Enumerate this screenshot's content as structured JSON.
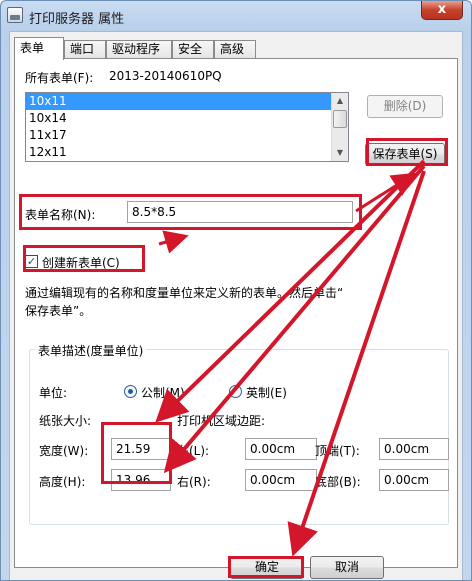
{
  "window": {
    "title": "打印服务器 属性",
    "close_label": "x"
  },
  "tabs": [
    {
      "label": "表单",
      "active": true
    },
    {
      "label": "端口"
    },
    {
      "label": "驱动程序"
    },
    {
      "label": "安全"
    },
    {
      "label": "高级"
    }
  ],
  "forms": {
    "label": "所有表单(F):",
    "server": "2013-20140610PQ",
    "items": [
      "10x11",
      "10x14",
      "11x17",
      "12x11"
    ],
    "selected_index": 0,
    "delete_label": "删除(D)",
    "save_label": "保存表单(S)"
  },
  "form_name": {
    "label": "表单名称(N):",
    "value": "8.5*8.5"
  },
  "create_new": {
    "label": "创建新表单(C)",
    "checked": true
  },
  "description": {
    "line1": "通过编辑现有的名称和度量单位来定义新的表单。然后单击“",
    "line2": "保存表单”。"
  },
  "group": {
    "title": "表单描述(度量单位)",
    "unit_label": "单位:",
    "metric_label": "公制(M)",
    "imperial_label": "英制(E)",
    "metric_selected": true,
    "paper_size_label": "纸张大小:",
    "margin_label": "打印机区域边距:",
    "width_label": "宽度(W):",
    "width_value": "21.59",
    "height_label": "高度(H):",
    "height_value": "13.96",
    "left_label": "左(L):",
    "left_value": "0.00cm",
    "right_label": "右(R):",
    "right_value": "0.00cm",
    "top_label": "顶端(T):",
    "top_value": "0.00cm",
    "bottom_label": "底部(B):",
    "bottom_value": "0.00cm"
  },
  "footer": {
    "ok_label": "确定",
    "cancel_label": "取消"
  },
  "colors": {
    "highlight": "#d4162a",
    "selection": "#3399ff"
  }
}
